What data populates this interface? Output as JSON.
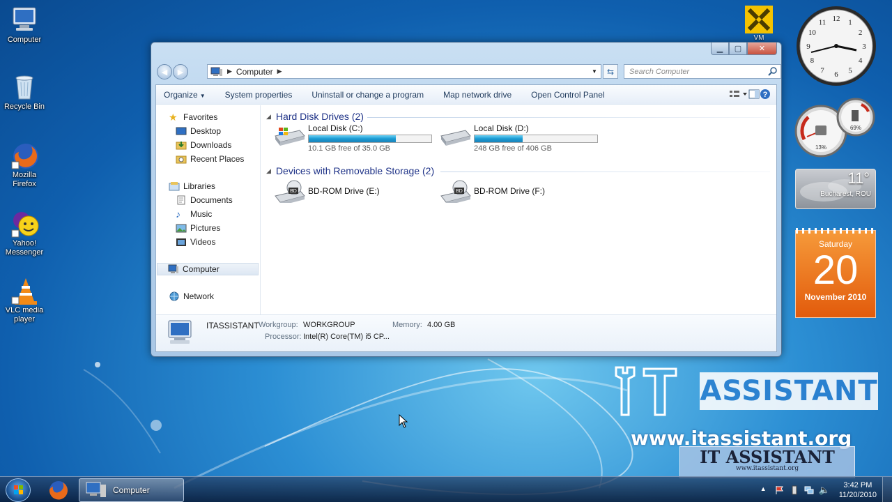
{
  "desktop": {
    "icons": [
      {
        "label": "Computer"
      },
      {
        "label": "Recycle Bin"
      },
      {
        "label": "Mozilla Firefox"
      },
      {
        "label": "Yahoo! Messenger"
      },
      {
        "label": "VLC media player"
      }
    ]
  },
  "window": {
    "address": {
      "crumb": "Computer"
    },
    "search_placeholder": "Search Computer",
    "toolbar": {
      "organize": "Organize",
      "system_properties": "System properties",
      "uninstall": "Uninstall or change a program",
      "map_drive": "Map network drive",
      "control_panel": "Open Control Panel"
    },
    "nav": {
      "favorites": "Favorites",
      "desktop": "Desktop",
      "downloads": "Downloads",
      "recent_places": "Recent Places",
      "libraries": "Libraries",
      "documents": "Documents",
      "music": "Music",
      "pictures": "Pictures",
      "videos": "Videos",
      "computer": "Computer",
      "network": "Network"
    },
    "groups": {
      "hard_disks": "Hard Disk Drives (2)",
      "removable": "Devices with Removable Storage (2)"
    },
    "drives": [
      {
        "name": "Local Disk (C:)",
        "free_text": "10.1 GB free of 35.0 GB",
        "used_fraction": 0.71
      },
      {
        "name": "Local Disk (D:)",
        "free_text": "248 GB free of 406 GB",
        "used_fraction": 0.39
      }
    ],
    "removable": [
      {
        "name": "BD-ROM Drive (E:)",
        "badge": "BD"
      },
      {
        "name": "BD-ROM Drive (F:)",
        "badge": "BD"
      }
    ],
    "details": {
      "computer_name": "ITASSISTANT",
      "workgroup_label": "Workgroup:",
      "workgroup": "WORKGROUP",
      "memory_label": "Memory:",
      "memory": "4.00 GB",
      "processor_label": "Processor:",
      "processor": "Intel(R) Core(TM) i5 CP..."
    }
  },
  "gadgets": {
    "clock_numbers": [
      "12",
      "1",
      "2",
      "3",
      "4",
      "5",
      "6",
      "7",
      "8",
      "9",
      "10",
      "11"
    ],
    "meter": {
      "cpu": "13%",
      "memory": "69%"
    },
    "weather": {
      "temp": "11°",
      "city": "Bucharest, ROU"
    },
    "calendar": {
      "weekday": "Saturday",
      "day": "20",
      "month_year": "November 2010"
    }
  },
  "watermark": {
    "vm_label": "VM",
    "assistant": "ASSISTANT",
    "url": "www.itassistant.org",
    "logo_big": "IT ASSISTANT",
    "logo_small": "www.itassistant.org"
  },
  "taskbar": {
    "task_label": "Computer",
    "time": "3:42 PM",
    "date": "11/20/2010"
  },
  "colors": {
    "accent": "#1e3287",
    "drive_fill": "#1a9ad3",
    "calendar": "#e25b0c"
  }
}
